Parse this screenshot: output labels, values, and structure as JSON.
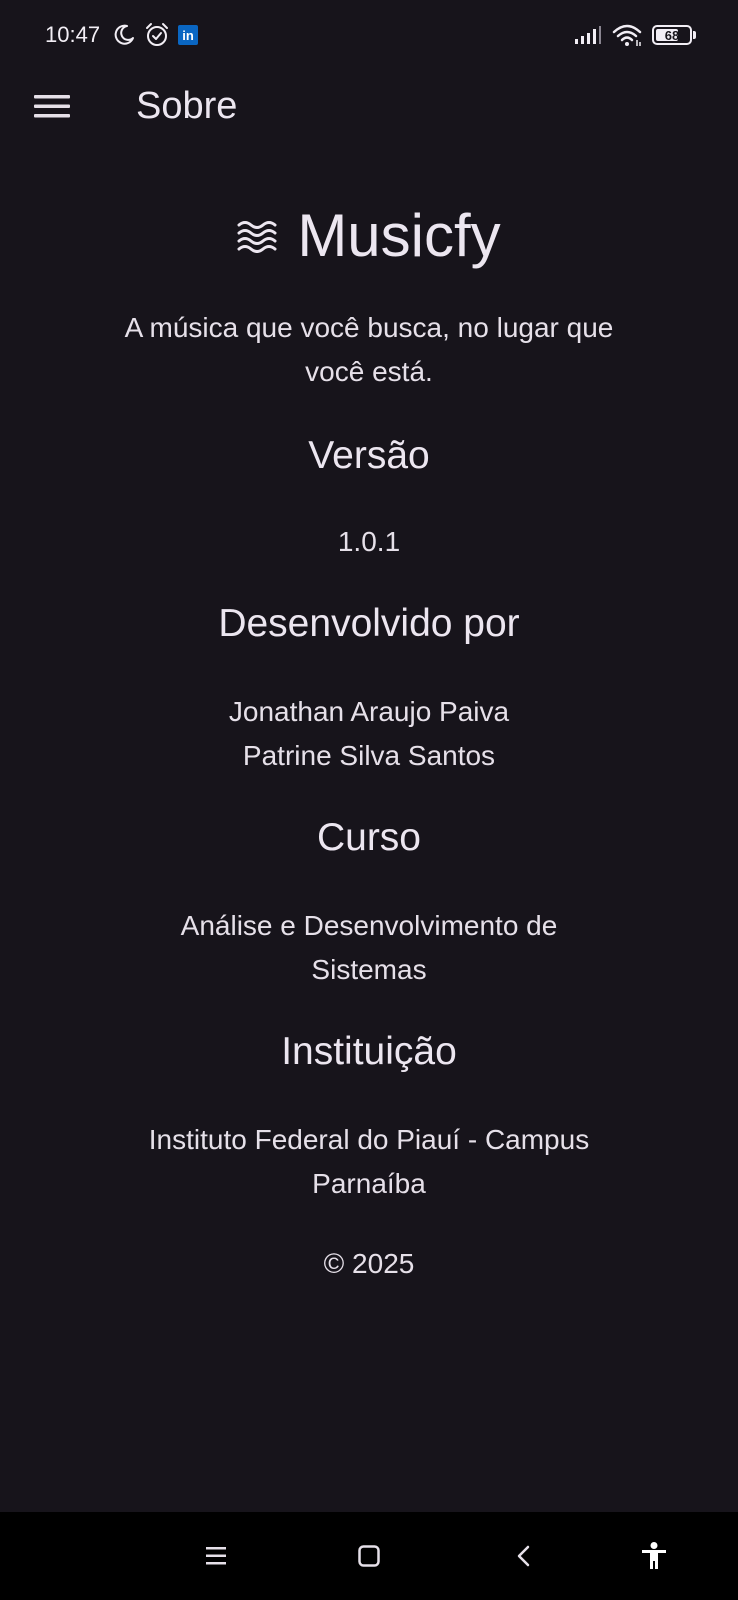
{
  "status_bar": {
    "time": "10:47",
    "battery_level": "68",
    "battery_fraction": 0.68,
    "icons_left": [
      "moon-icon",
      "alarm-icon",
      "linkedin-icon"
    ],
    "icons_right": [
      "signal-icon",
      "wifi-icon",
      "battery-icon"
    ],
    "linkedin_label": "in"
  },
  "app_bar": {
    "title": "Sobre",
    "menu_icon": "menu-icon"
  },
  "about": {
    "logo_icon": "waves-icon",
    "app_name": "Musicfy",
    "tagline": "A música que você busca, no lugar que você está.",
    "version_title": "Versão",
    "version_value": "1.0.1",
    "developers_title": "Desenvolvido por",
    "developers": [
      "Jonathan Araujo Paiva",
      "Patrine Silva Santos"
    ],
    "course_title": "Curso",
    "course_value": "Análise e Desenvolvimento de Sistemas",
    "institution_title": "Instituição",
    "institution_value": "Instituto Federal do Piauí - Campus Parnaíba",
    "copyright": "© 2025"
  },
  "nav_bar": {
    "buttons": [
      "recents-icon",
      "home-icon",
      "back-icon",
      "accessibility-icon"
    ]
  },
  "colors": {
    "background": "#17141b",
    "text": "#e6e0e9",
    "nav_background": "#000000"
  }
}
